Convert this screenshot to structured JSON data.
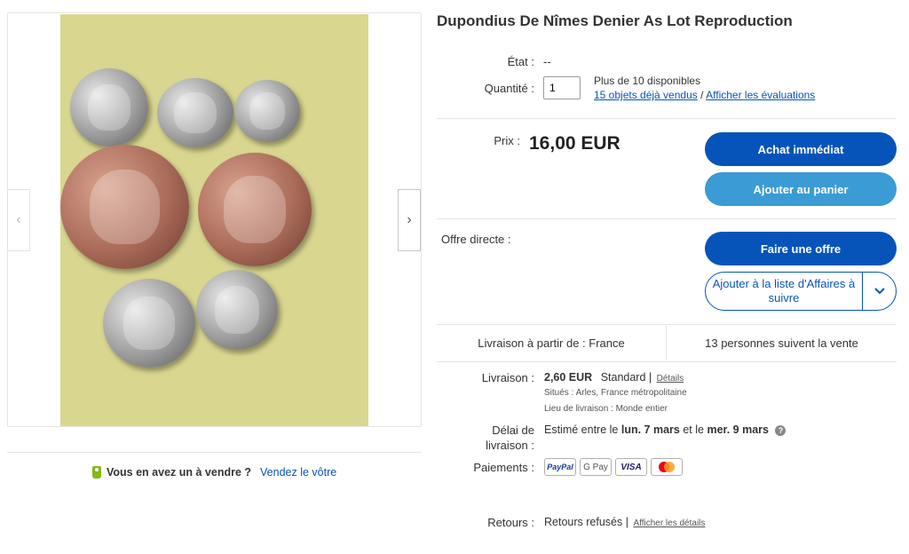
{
  "gallery": {
    "prev_icon": "‹",
    "next_icon": "›",
    "coins": [
      {
        "metal": "silver"
      },
      {
        "metal": "silver"
      },
      {
        "metal": "silver"
      },
      {
        "metal": "copper"
      },
      {
        "metal": "copper"
      },
      {
        "metal": "silver"
      },
      {
        "metal": "silver"
      }
    ]
  },
  "sell": {
    "question": "Vous en avez un à vendre ?",
    "link": "Vendez le vôtre"
  },
  "item": {
    "title": "Dupondius De Nîmes Denier As Lot Reproduction",
    "condition_label": "État :",
    "condition_value": "--",
    "quantity_label": "Quantité :",
    "quantity_value": "1",
    "availability": "Plus de 10 disponibles",
    "sold_link": "15 objets déjà vendus",
    "sold_sep": "/",
    "reviews_link": "Afficher les évaluations",
    "price_label": "Prix :",
    "price": "16,00 EUR",
    "buy_now": "Achat immédiat",
    "add_to_cart": "Ajouter au panier",
    "best_offer_label": "Offre directe :",
    "make_offer": "Faire une offre",
    "watchlist": "Ajouter à la liste d'Affaires à suivre",
    "watchlist_chevron": "⌄"
  },
  "shipping_bar": {
    "ships_from": "Livraison à partir de : France",
    "watchers": "13 personnes suivent la vente"
  },
  "details": {
    "delivery_label": "Livraison :",
    "delivery_price": "2,60 EUR",
    "delivery_type": "Standard |",
    "delivery_details": "Détails",
    "located": "Situés :  Arles, France métropolitaine",
    "ship_to": "Lieu de livraison :  Monde entier",
    "delay_label_1": "Délai de",
    "delay_label_2": "livraison :",
    "delay_text_1": "Estimé entre le",
    "delay_date_1": "lun. 7 mars",
    "delay_text_2": "et le",
    "delay_date_2": "mer. 9 mars",
    "payments_label": "Paiements :",
    "payment_methods": [
      "PayPal",
      "G Pay",
      "VISA",
      ""
    ],
    "returns_label": "Retours :",
    "returns_text": "Retours refusés |",
    "returns_link": "Afficher les détails"
  }
}
